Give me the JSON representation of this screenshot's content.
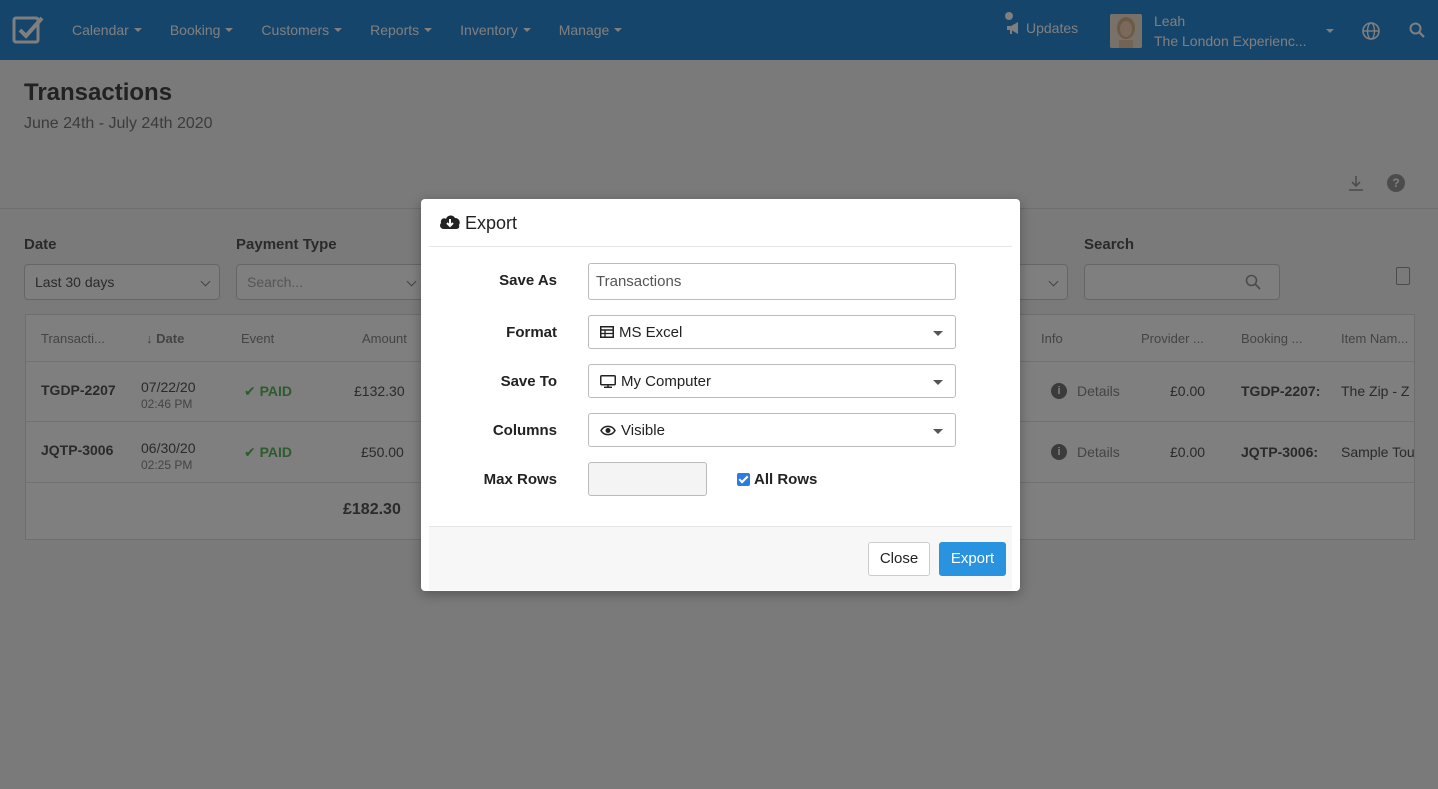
{
  "navbar": {
    "items": [
      {
        "label": "Calendar"
      },
      {
        "label": "Booking"
      },
      {
        "label": "Customers"
      },
      {
        "label": "Reports"
      },
      {
        "label": "Inventory"
      },
      {
        "label": "Manage"
      }
    ],
    "updates_label": "Updates",
    "user_name": "Leah",
    "user_company": "The London Experienc...",
    "accent_color": "#2c8ad6"
  },
  "page": {
    "title": "Transactions",
    "subtitle": "June 24th - July 24th 2020"
  },
  "filters": {
    "date_label": "Date",
    "date_value": "Last 30 days",
    "payment_type_label": "Payment Type",
    "payment_type_placeholder": "Search...",
    "search_label": "Search"
  },
  "table": {
    "headers_left": [
      "Transacti...",
      "Date",
      "Event",
      "Amount"
    ],
    "headers_right": [
      "Info",
      "Provider ...",
      "Booking ...",
      "Item Nam..."
    ],
    "rows": [
      {
        "id": "TGDP-2207",
        "date": "07/22/20",
        "time": "02:46 PM",
        "event": "PAID",
        "amount": "£132.30",
        "info": "Details",
        "provider": "£0.00",
        "booking": "TGDP-2207:",
        "item": "The Zip - Z"
      },
      {
        "id": "JQTP-3006",
        "date": "06/30/20",
        "time": "02:25 PM",
        "event": "PAID",
        "amount": "£50.00",
        "info": "Details",
        "provider": "£0.00",
        "booking": "JQTP-3006:",
        "item": "Sample Tou"
      }
    ],
    "total": "£182.30"
  },
  "modal": {
    "title": "Export",
    "save_as_label": "Save As",
    "save_as_value": "Transactions",
    "format_label": "Format",
    "format_value": "MS Excel",
    "save_to_label": "Save To",
    "save_to_value": "My Computer",
    "columns_label": "Columns",
    "columns_value": "Visible",
    "max_rows_label": "Max Rows",
    "max_rows_value": "",
    "all_rows_label": "All Rows",
    "all_rows_checked": true,
    "close_label": "Close",
    "export_label": "Export",
    "export_color": "#2a93df"
  }
}
